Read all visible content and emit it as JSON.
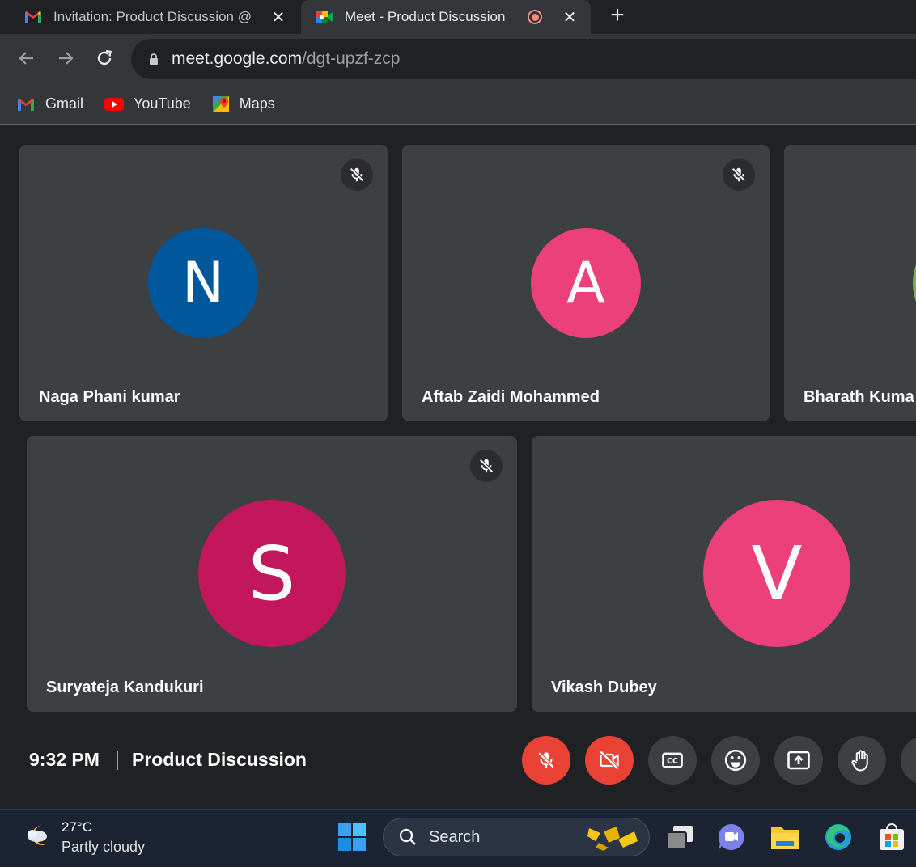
{
  "browser": {
    "tabs": [
      {
        "title": "Invitation: Product Discussion @",
        "favicon": "gmail-icon",
        "active": false
      },
      {
        "title": "Meet - Product Discussion",
        "favicon": "meet-icon",
        "active": true,
        "recording": true
      }
    ],
    "address": {
      "host": "meet.google.com",
      "path": "/dgt-upzf-zcp"
    },
    "bookmarks": [
      {
        "label": "Gmail",
        "icon": "gmail-icon"
      },
      {
        "label": "YouTube",
        "icon": "youtube-icon"
      },
      {
        "label": "Maps",
        "icon": "maps-icon"
      }
    ]
  },
  "meet": {
    "participants": [
      {
        "initial": "N",
        "name": "Naga Phani kumar",
        "color": "#01579b",
        "muted": true
      },
      {
        "initial": "A",
        "name": "Aftab Zaidi Mohammed",
        "color": "#ec407a",
        "muted": true
      },
      {
        "initial": "",
        "name": "Bharath Kuma",
        "color": "#7cb342",
        "muted": false
      },
      {
        "initial": "S",
        "name": "Suryateja Kandukuri",
        "color": "#c2185b",
        "muted": true
      },
      {
        "initial": "V",
        "name": "Vikash Dubey",
        "color": "#ec407a",
        "muted": false
      }
    ],
    "time": "9:32 PM",
    "meeting_name": "Product Discussion",
    "controls": [
      "mic-off-icon",
      "camera-off-icon",
      "captions-icon",
      "emoji-icon",
      "present-icon",
      "raise-hand-icon"
    ]
  },
  "taskbar": {
    "weather_temp": "27°C",
    "weather_desc": "Partly cloudy",
    "search_label": "Search"
  },
  "colors": {
    "accent_red": "#ea4335",
    "tile": "#3c4043",
    "background": "#202124"
  }
}
